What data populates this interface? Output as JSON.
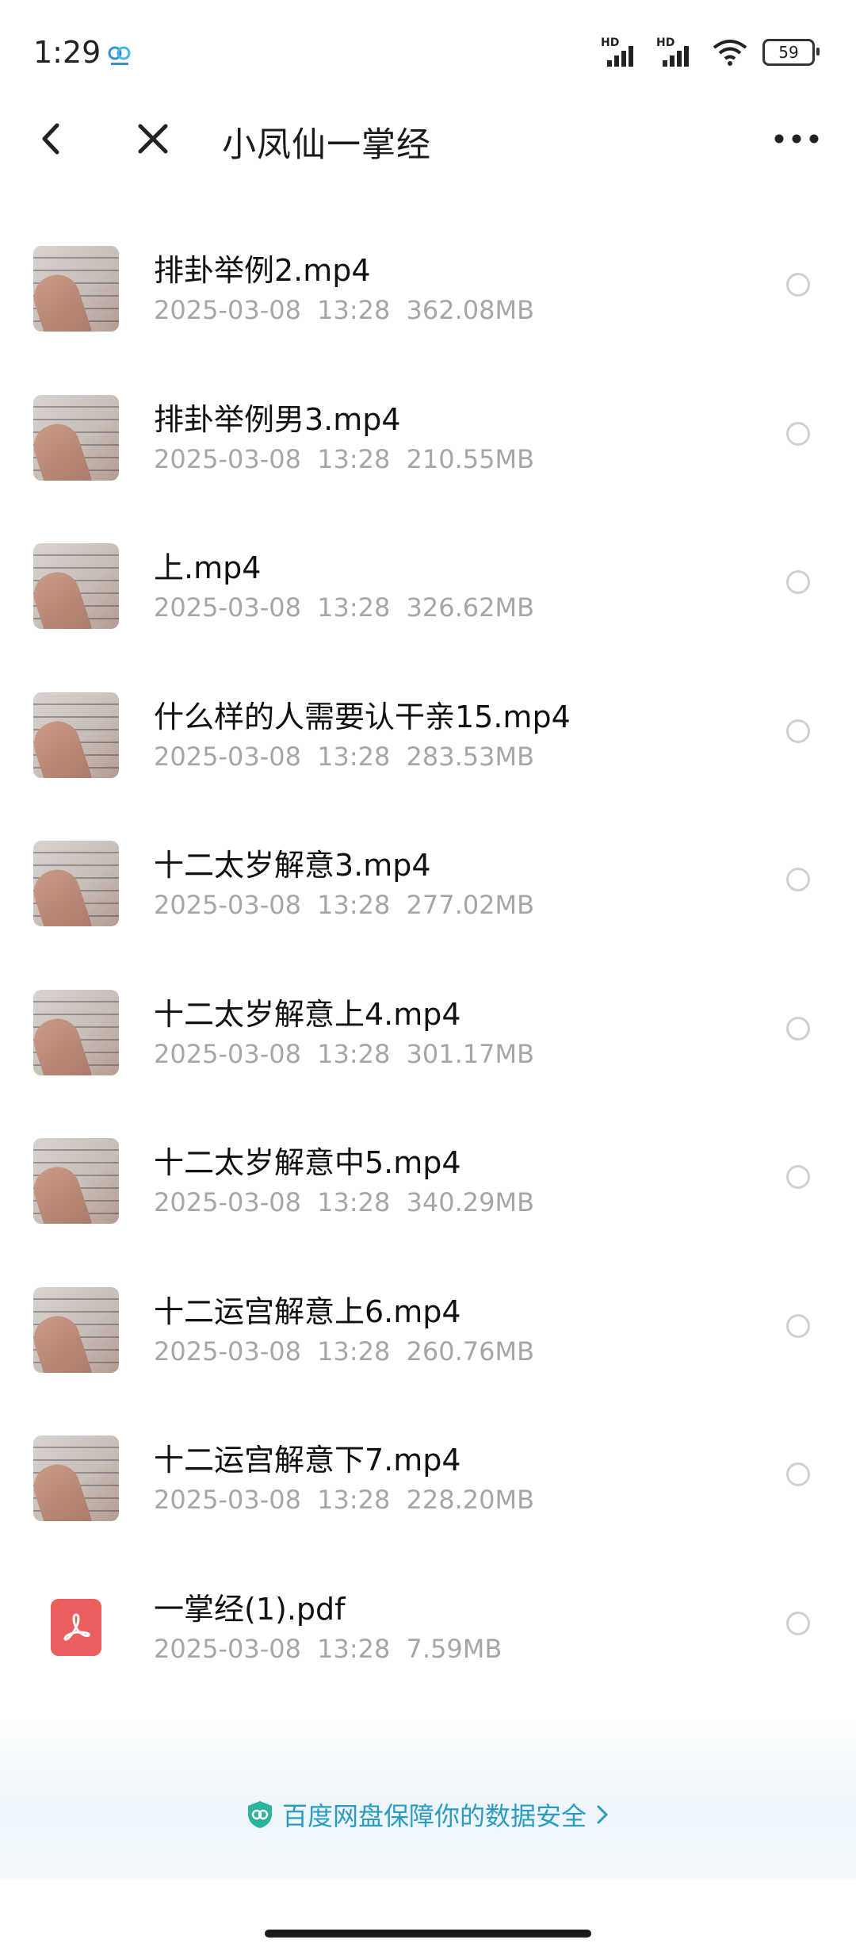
{
  "status_bar": {
    "time": "1:29",
    "signal_label_1": "HD",
    "signal_label_2": "HD",
    "battery": "59"
  },
  "nav": {
    "title": "小凤仙一掌经",
    "back_icon": "chevron-left-icon",
    "close_icon": "close-icon",
    "more_icon": "more-horizontal-icon"
  },
  "files": [
    {
      "name": "排卦举例2.mp4",
      "date": "2025-03-08",
      "time": "13:28",
      "size": "362.08MB",
      "type": "video"
    },
    {
      "name": "排卦举例男3.mp4",
      "date": "2025-03-08",
      "time": "13:28",
      "size": "210.55MB",
      "type": "video"
    },
    {
      "name": "上.mp4",
      "date": "2025-03-08",
      "time": "13:28",
      "size": "326.62MB",
      "type": "video"
    },
    {
      "name": "什么样的人需要认干亲15.mp4",
      "date": "2025-03-08",
      "time": "13:28",
      "size": "283.53MB",
      "type": "video"
    },
    {
      "name": "十二太岁解意3.mp4",
      "date": "2025-03-08",
      "time": "13:28",
      "size": "277.02MB",
      "type": "video"
    },
    {
      "name": "十二太岁解意上4.mp4",
      "date": "2025-03-08",
      "time": "13:28",
      "size": "301.17MB",
      "type": "video"
    },
    {
      "name": "十二太岁解意中5.mp4",
      "date": "2025-03-08",
      "time": "13:28",
      "size": "340.29MB",
      "type": "video"
    },
    {
      "name": "十二运宫解意上6.mp4",
      "date": "2025-03-08",
      "time": "13:28",
      "size": "260.76MB",
      "type": "video"
    },
    {
      "name": "十二运宫解意下7.mp4",
      "date": "2025-03-08",
      "time": "13:28",
      "size": "228.20MB",
      "type": "video"
    },
    {
      "name": "一掌经(1).pdf",
      "date": "2025-03-08",
      "time": "13:28",
      "size": "7.59MB",
      "type": "pdf"
    }
  ],
  "footer": {
    "security_text": "百度网盘保障你的数据安全",
    "icon": "shield-icon",
    "color": "#2b9bc4"
  },
  "colors": {
    "meta_text": "#a6a6a6",
    "pdf_icon": "#ea5e5e"
  }
}
